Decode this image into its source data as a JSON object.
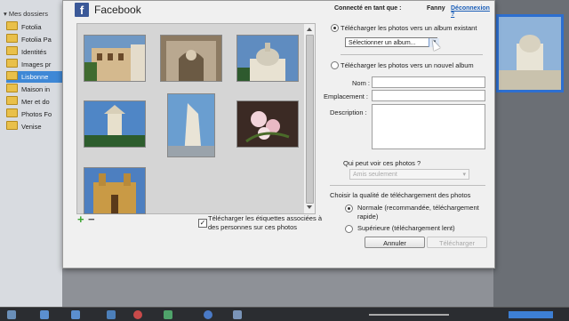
{
  "sidebar": {
    "header": "Mes dossiers",
    "items": [
      {
        "label": "Fotolia"
      },
      {
        "label": "Fotolia Pa"
      },
      {
        "label": "Identités"
      },
      {
        "label": "Images pr"
      },
      {
        "label": "Lisbonne",
        "selected": true
      },
      {
        "label": "Maison in"
      },
      {
        "label": "Mer et do"
      },
      {
        "label": "Photos Fo"
      },
      {
        "label": "Venise"
      }
    ]
  },
  "dialog": {
    "logo_letter": "f",
    "title": "Facebook",
    "connected_label": "Connecté en tant que :",
    "user_name": "Fanny",
    "logout": "Déconnexion ?"
  },
  "photos": {
    "items": [
      {
        "subject": "facade-lisbonne"
      },
      {
        "subject": "sculpture-arche"
      },
      {
        "subject": "dome-cathedrale"
      },
      {
        "subject": "tour-belem"
      },
      {
        "subject": "monument-decouvertes"
      },
      {
        "subject": "fleurs-roses"
      },
      {
        "subject": "facade-doree"
      }
    ],
    "add_icon": "plus-icon",
    "remove_icon": "minus-icon",
    "upload_tags_label": "Télécharger les étiquettes associées à des personnes sur ces photos",
    "upload_tags_checked": true
  },
  "upload": {
    "existing_album_label": "Télécharger les photos vers un album existant",
    "existing_album_selected": true,
    "album_select_value": "Sélectionner un album...",
    "new_album_label": "Télécharger les photos vers un nouvel album",
    "fields": {
      "name_label": "Nom :",
      "location_label": "Emplacement :",
      "description_label": "Description :"
    },
    "privacy_question": "Qui peut voir ces photos ?",
    "privacy_value": "Amis seulement",
    "quality_title": "Choisir la qualité de téléchargement des photos",
    "quality_normal": "Normale (recommandée, téléchargement rapide)",
    "quality_high": "Supérieure (téléchargement lent)",
    "cancel_button": "Annuler",
    "upload_button": "Télécharger"
  },
  "colors": {
    "facebook_blue": "#3b5998",
    "selection_blue": "#3f88d6",
    "link_blue": "#1c5fb8"
  }
}
